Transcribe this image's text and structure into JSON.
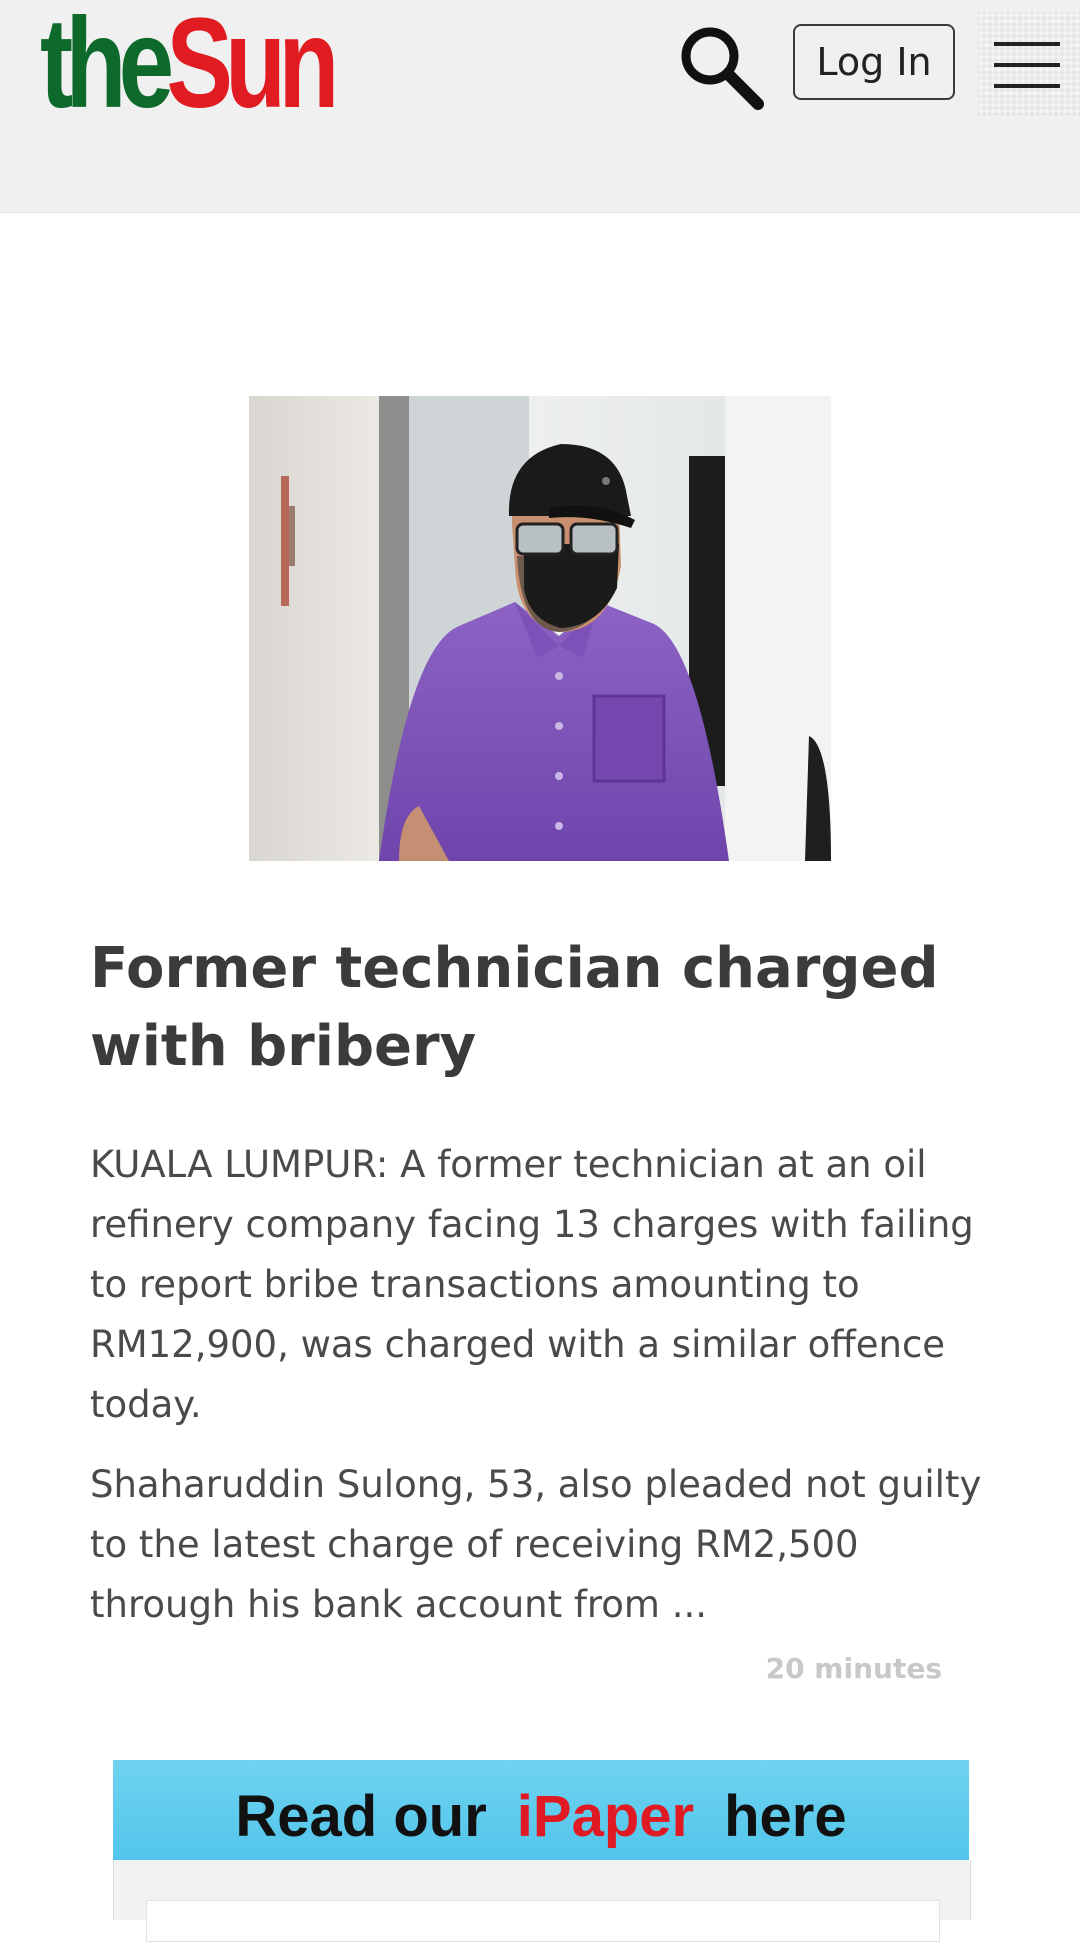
{
  "header": {
    "logo_the": "the",
    "logo_sun": "Sun",
    "login_label": "Log In",
    "colors": {
      "logo_green": "#0d6a2b",
      "logo_red": "#e11b22",
      "header_bg": "#f0f0f0"
    }
  },
  "article": {
    "headline": "Former technician charged with bribery",
    "paragraph_1": "KUALA LUMPUR: A former technician at an oil refinery company facing 13 charges with failing to report bribe transactions amounting to RM12,900, was charged with a similar offence today.",
    "paragraph_2": "Shaharuddin Sulong, 53, also pleaded not guilty to the latest charge of receiving RM2,500 through his bank account from ...",
    "time_ago": "20 minutes"
  },
  "promo": {
    "text_prefix": "Read our",
    "text_accent": "iPaper",
    "text_suffix": "here",
    "colors": {
      "band": "#4fc3ea",
      "accent": "#e01a22"
    }
  },
  "icons": [
    "search-icon",
    "hamburger-menu-icon"
  ]
}
